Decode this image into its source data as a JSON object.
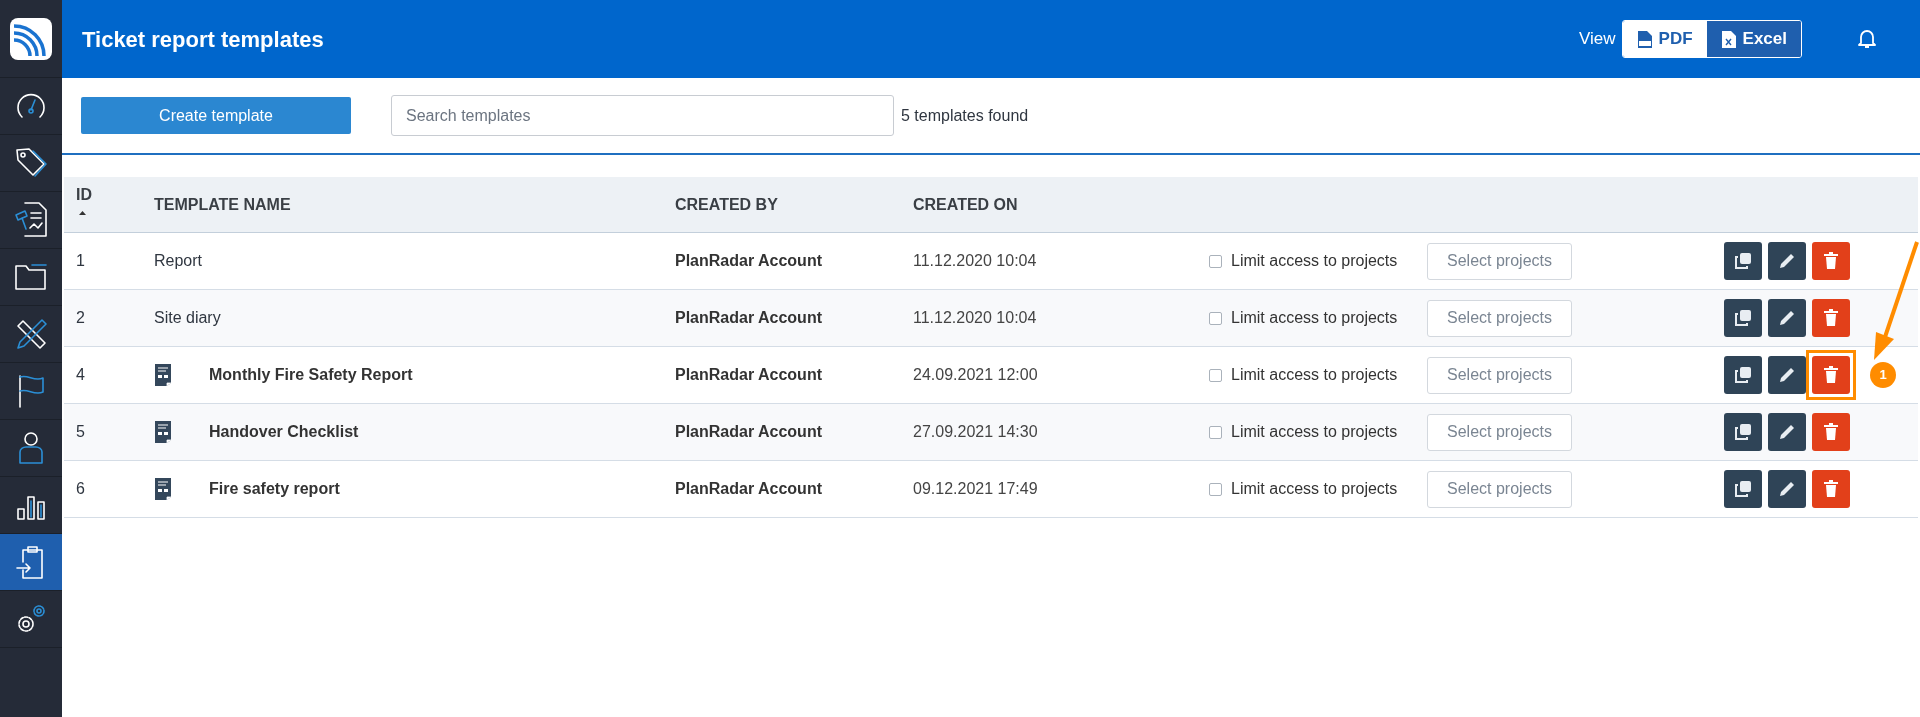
{
  "sidebar": {
    "items": [
      {
        "kind": "logo",
        "selected": false
      },
      {
        "kind": "gauge",
        "selected": false
      },
      {
        "kind": "tag",
        "selected": false
      },
      {
        "kind": "report",
        "selected": false
      },
      {
        "kind": "folder",
        "selected": false
      },
      {
        "kind": "tools",
        "selected": false
      },
      {
        "kind": "flag",
        "selected": false
      },
      {
        "kind": "user",
        "selected": false
      },
      {
        "kind": "chart",
        "selected": false
      },
      {
        "kind": "clipboard",
        "selected": true
      },
      {
        "kind": "settings",
        "selected": false
      }
    ]
  },
  "header": {
    "title": "Ticket report templates",
    "view_label": "View",
    "view_options": [
      {
        "kind": "pdf",
        "label": "PDF",
        "selected": true
      },
      {
        "kind": "excel",
        "label": "Excel",
        "selected": false
      }
    ]
  },
  "toolbar": {
    "create_button": "Create template",
    "search": {
      "placeholder": "Search templates"
    },
    "result_count": "5 templates found"
  },
  "table": {
    "columns": [
      {
        "label": "ID",
        "sorted": true
      },
      {
        "label": "TEMPLATE NAME",
        "sorted": false
      },
      {
        "label": "CREATED BY",
        "sorted": false
      },
      {
        "label": "CREATED ON",
        "sorted": false
      }
    ],
    "rows": [
      {
        "id": "1",
        "name": "Report",
        "kind": "basic",
        "created_by": "PlanRadar Account",
        "created_on": "11.12.2020 10:04",
        "limit_label": "Limit access to projects",
        "checked": false,
        "select_button": "Select projects",
        "highlighted": false
      },
      {
        "id": "2",
        "name": "Site diary",
        "kind": "basic",
        "created_by": "PlanRadar Account",
        "created_on": "11.12.2020 10:04",
        "limit_label": "Limit access to projects",
        "checked": false,
        "select_button": "Select projects",
        "highlighted": false
      },
      {
        "id": "4",
        "name": "Monthly Fire Safety Report",
        "kind": "document",
        "created_by": "PlanRadar Account",
        "created_on": "24.09.2021 12:00",
        "limit_label": "Limit access to projects",
        "checked": false,
        "select_button": "Select projects",
        "highlighted": true
      },
      {
        "id": "5",
        "name": "Handover Checklist",
        "kind": "document",
        "created_by": "PlanRadar Account",
        "created_on": "27.09.2021 14:30",
        "limit_label": "Limit access to projects",
        "checked": false,
        "select_button": "Select projects",
        "highlighted": false
      },
      {
        "id": "6",
        "name": "Fire safety report",
        "kind": "document",
        "created_by": "PlanRadar Account",
        "created_on": "09.12.2021 17:49",
        "limit_label": "Limit access to projects",
        "checked": false,
        "select_button": "Select projects",
        "highlighted": false
      }
    ]
  },
  "annotation": {
    "badge": "1"
  }
}
